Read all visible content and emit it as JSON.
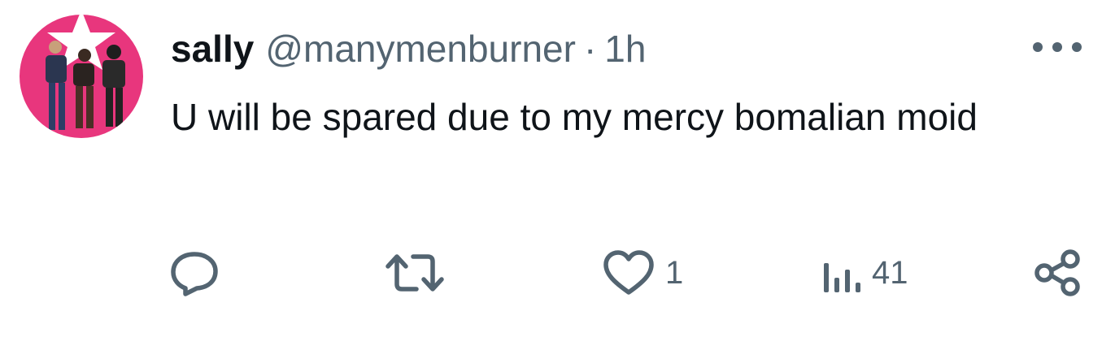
{
  "tweet": {
    "author": {
      "display_name": "sally",
      "handle": "@manymenburner",
      "avatar_icon": "avatar-photo"
    },
    "separator": "·",
    "timestamp": "1h",
    "text": "U will be spared due to my mercy bomalian moid",
    "more_icon": "more-icon",
    "actions": {
      "reply": {
        "icon": "reply-icon",
        "count": ""
      },
      "repost": {
        "icon": "repost-icon",
        "count": ""
      },
      "like": {
        "icon": "heart-icon",
        "count": "1"
      },
      "views": {
        "icon": "views-icon",
        "count": "41"
      },
      "share": {
        "icon": "share-icon"
      }
    }
  },
  "colors": {
    "text_primary": "#0f1419",
    "text_secondary": "#536471",
    "avatar_background": "#e8367d"
  }
}
